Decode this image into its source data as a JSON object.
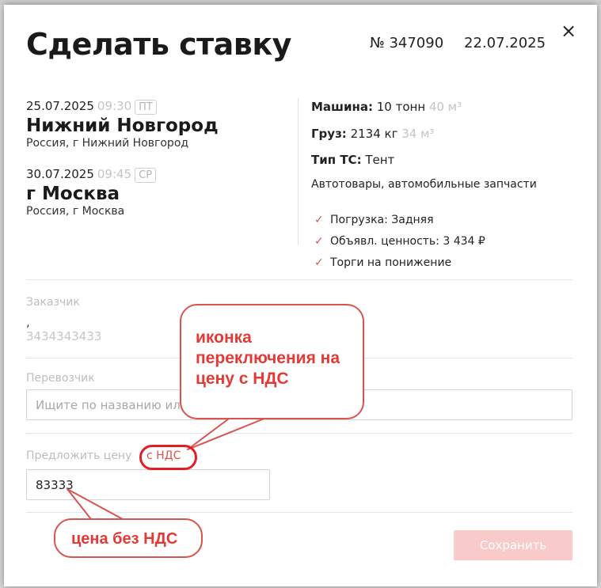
{
  "modal": {
    "title": "Сделать ставку",
    "order_number": "№ 347090",
    "order_date": "22.07.2025",
    "close_glyph": "×"
  },
  "route": {
    "pickup": {
      "date": "25.07.2025",
      "time": "09:30",
      "day": "ПТ",
      "city": "Нижний Новгород",
      "address": "Россия, г Нижний Новгород"
    },
    "delivery": {
      "date": "30.07.2025",
      "time": "09:45",
      "day": "СР",
      "city": "г Москва",
      "address": "Россия, г Москва"
    }
  },
  "specs": {
    "vehicle_label": "Машина:",
    "vehicle_value": "10 тонн",
    "vehicle_volume": "40 м³",
    "cargo_label": "Груз:",
    "cargo_value": "2134 кг",
    "cargo_volume": "34 м³",
    "truck_type_label": "Тип ТС:",
    "truck_type_value": "Тент",
    "cargo_description": "Автотовары, автомобильные запчасти",
    "checks": [
      "Погрузка: Задняя",
      "Объявл. ценность: 3 434 ₽",
      "Торги на понижение"
    ]
  },
  "customer": {
    "label": "Заказчик",
    "name": ",",
    "phone": "3434343433"
  },
  "carrier": {
    "label": "Перевозчик",
    "placeholder": "Ищите по названию или ИНН"
  },
  "price": {
    "label": "Предложить цену",
    "vat_toggle": "с НДС",
    "value": "83333"
  },
  "save_label": "Сохранить",
  "annotations": {
    "vat_icon_note": "иконка переключения на цену с НДС",
    "price_note": "цена без НДС"
  },
  "colors": {
    "accent": "#d9534f",
    "annotation": "#e51c23",
    "save_disabled": "#f8caca"
  }
}
